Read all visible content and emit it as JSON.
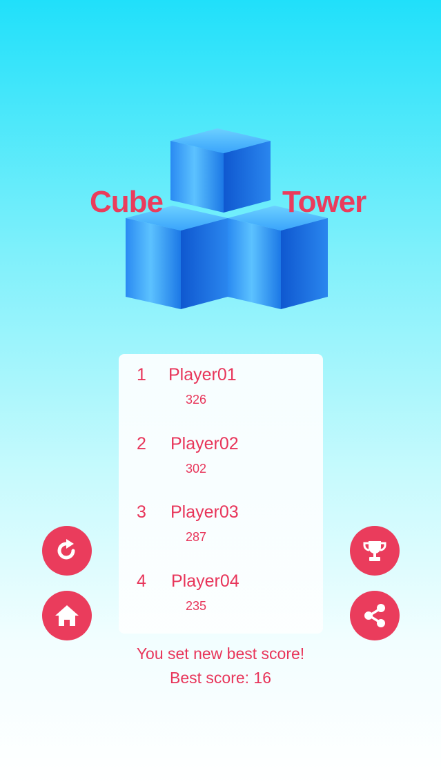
{
  "colors": {
    "accent": "#ea3c5c",
    "text_red": "#e8355a",
    "cube_light": "#4fb6ff",
    "cube_mid": "#1f86ee",
    "cube_dark": "#0c4fc8"
  },
  "logo": {
    "word1": "Cube",
    "word2": "Tower"
  },
  "leaderboard": [
    {
      "rank": "1",
      "name": "Player01",
      "score": "326"
    },
    {
      "rank": "2",
      "name": "Player02",
      "score": "302"
    },
    {
      "rank": "3",
      "name": "Player03",
      "score": "287"
    },
    {
      "rank": "4",
      "name": "Player04",
      "score": "235"
    }
  ],
  "buttons": {
    "restart_icon": "restart-icon",
    "home_icon": "home-icon",
    "trophy_icon": "trophy-icon",
    "share_icon": "share-icon"
  },
  "result": {
    "new_best_message": "You set new best score!",
    "best_score_text": "Best score: 16"
  }
}
